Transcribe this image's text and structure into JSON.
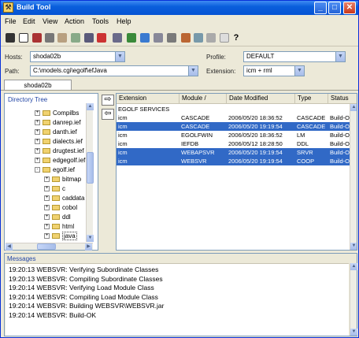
{
  "window": {
    "title": "Build Tool",
    "minimize": "_",
    "maximize": "□",
    "close": "✕"
  },
  "menu": [
    "File",
    "Edit",
    "View",
    "Action",
    "Tools",
    "Help"
  ],
  "toolbar": {
    "help_label": "?"
  },
  "form": {
    "hosts_label": "Hosts:",
    "hosts_value": "shoda02b",
    "path_label": "Path:",
    "path_value": "C:\\models.cgi\\egolf\\efJava",
    "profile_label": "Profile:",
    "profile_value": "DEFAULT",
    "extension_label": "Extension:",
    "extension_value": "icm + rml"
  },
  "tab": {
    "label": "shoda02b"
  },
  "directory_tree": {
    "header": "Directory Tree",
    "items": [
      {
        "label": "Compilbs",
        "level": 0,
        "toggle": "+"
      },
      {
        "label": "danrep.ief",
        "level": 0,
        "toggle": "+"
      },
      {
        "label": "danth.ief",
        "level": 0,
        "toggle": "+"
      },
      {
        "label": "dialects.ief",
        "level": 0,
        "toggle": "+"
      },
      {
        "label": "drugtest.ief",
        "level": 0,
        "toggle": "+"
      },
      {
        "label": "edgegolf.ief",
        "level": 0,
        "toggle": "+"
      },
      {
        "label": "egolf.ief",
        "level": 0,
        "toggle": "-"
      },
      {
        "label": "bitmap",
        "level": 1,
        "toggle": "+"
      },
      {
        "label": "c",
        "level": 1,
        "toggle": "+"
      },
      {
        "label": "caddata",
        "level": 1,
        "toggle": "+"
      },
      {
        "label": "cobol",
        "level": 1,
        "toggle": "+"
      },
      {
        "label": "ddl",
        "level": 1,
        "toggle": "+"
      },
      {
        "label": "html",
        "level": 1,
        "toggle": "+"
      },
      {
        "label": "java",
        "level": 1,
        "toggle": "+"
      }
    ]
  },
  "transfer": {
    "right": "⇨",
    "left": "⇦"
  },
  "table": {
    "columns": [
      "Extension",
      "Module /",
      "Date Modified",
      "Type",
      "Status"
    ],
    "group": "EGOLF SERVICES",
    "rows": [
      {
        "ext": "icm",
        "module": "CASCADE",
        "date": "2006/05/20 18:36:52",
        "type": "CASCADE",
        "status": "Build-OK",
        "selected": false
      },
      {
        "ext": "icm",
        "module": "CASCADE",
        "date": "2006/05/20 19:19:54",
        "type": "CASCADE",
        "status": "Build-OK",
        "selected": true
      },
      {
        "ext": "icm",
        "module": "EGOLFWIN",
        "date": "2006/05/20 18:36:52",
        "type": "LM",
        "status": "Build-OK",
        "selected": false
      },
      {
        "ext": "icm",
        "module": "IEFDB",
        "date": "2006/05/12 18:28:50",
        "type": "DDL",
        "status": "Build-OK",
        "selected": false
      },
      {
        "ext": "icm",
        "module": "WEBAPSVR",
        "date": "2006/05/20 19:19:54",
        "type": "SRVR",
        "status": "Build-OK",
        "selected": true
      },
      {
        "ext": "icm",
        "module": "WEBSVR",
        "date": "2006/05/20 19:19:54",
        "type": "COOP",
        "status": "Build-OK",
        "selected": true
      }
    ]
  },
  "messages": {
    "header": "Messages",
    "lines": [
      "19:20:13 WEBSVR: Verifying Subordinate Classes",
      "19:20:13 WEBSVR: Compiling Subordinate Classes",
      "19:20:14 WEBSVR: Verifying Load Module Class",
      "19:20:14 WEBSVR: Compiling Load Module Class",
      "19:20:14 WEBSVR: Building WEBSVR\\WEBSVR.jar",
      "19:20:14 WEBSVR: Build-OK"
    ]
  }
}
